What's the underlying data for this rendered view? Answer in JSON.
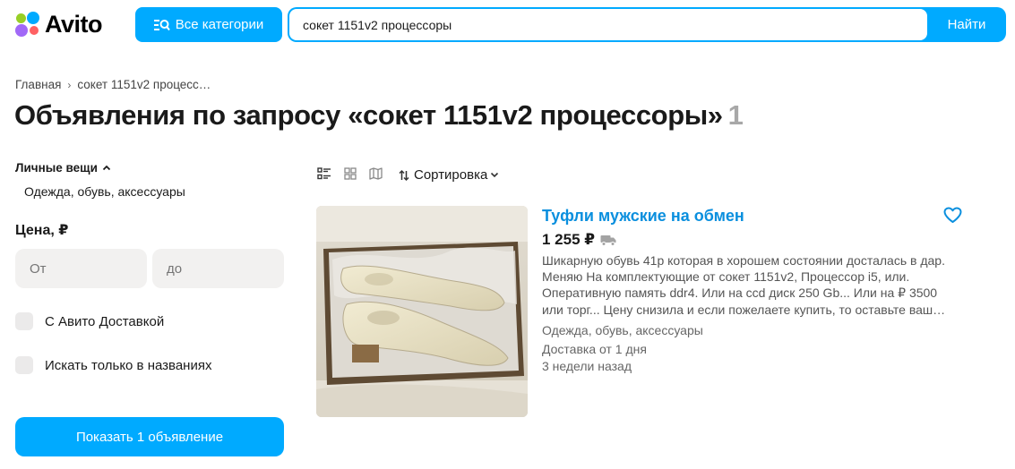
{
  "header": {
    "logo_text": "Avito",
    "categories_button": "Все категории",
    "search_value": "сокет 1151v2 процессоры",
    "search_button": "Найти",
    "accent_color": "#00aaff"
  },
  "breadcrumb": {
    "home": "Главная",
    "current": "сокет 1151v2 процесс…"
  },
  "title": {
    "text": "Объявления по запросу «сокет 1151v2 процессоры»",
    "count": "1"
  },
  "filters": {
    "category": "Личные вещи",
    "subcategory": "Одежда, обувь, аксессуары",
    "price_label": "Цена, ₽",
    "price_from_placeholder": "От",
    "price_to_placeholder": "до",
    "delivery_checkbox": "С Авито Доставкой",
    "title_only_checkbox": "Искать только в названиях",
    "show_button": "Показать 1 объявление"
  },
  "view": {
    "sort_label": "Сортировка"
  },
  "listing": {
    "title": "Туфли мужские на обмен",
    "price": "1 255 ₽",
    "description_lines": [
      "Шикарную обувь 41р которая в хорошем состоянии досталась в дар.",
      "Меняю На комплектующие от сокет 1151v2, Процессор i5, или.",
      "Оперативную память ddr4. Или на ccd диск 250 Gb... Или на ₽ 3500",
      "или торг... Цену снизила и если пожелаете купить, то оставьте ваш…"
    ],
    "category": "Одежда, обувь, аксессуары",
    "delivery": "Доставка от 1 дня",
    "posted": "3 недели назад",
    "title_color": "#0a8fde"
  }
}
